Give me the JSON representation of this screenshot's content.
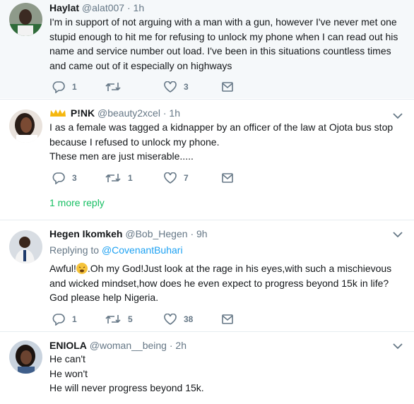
{
  "tweets": [
    {
      "name": "Haylat",
      "handle": "@alat007",
      "dot": "·",
      "time": "1h",
      "lines": [
        "I'm in support of not arguing with a man with a gun, however I've never met one",
        "stupid enough to hit me for refusing to unlock my phone when I can read out his",
        "name and service number out load. I've been in this situations countless times",
        "and came out of it especially on highways"
      ],
      "reply_count": "1",
      "retweet_count": "",
      "like_count": "3"
    },
    {
      "name": "P!NK",
      "handle": "@beauty2xcel",
      "dot": "·",
      "time": "1h",
      "lines": [
        "I as a female was tagged a kidnapper by an officer of the law at Ojota bus stop",
        "because I refused to unlock my phone.",
        "These men are just miserable....."
      ],
      "reply_count": "3",
      "retweet_count": "1",
      "like_count": "7",
      "more_replies": "1 more reply"
    },
    {
      "name": "Hegen Ikomkeh",
      "handle": "@Bob_Hegen",
      "dot": "·",
      "time": "9h",
      "replying_prefix": "Replying to",
      "replying_to": "@CovenantBuhari",
      "line1_a": "Awful!",
      "line1_b": ".Oh my God!Just look at the rage in his eyes,with such a mischievous",
      "lines": [
        "and wicked mindset,how does he even expect to progress beyond 15k in life?",
        "God please help Nigeria."
      ],
      "reply_count": "1",
      "retweet_count": "5",
      "like_count": "38"
    },
    {
      "name": "ENIOLA",
      "handle": "@woman__being",
      "dot": "·",
      "time": "2h",
      "lines": [
        "He can't",
        "He won't",
        "He will never progress beyond 15k."
      ]
    }
  ],
  "colors": {
    "reply_green": "#17bf63",
    "link_blue": "#1da1f2",
    "muted": "#657786"
  }
}
